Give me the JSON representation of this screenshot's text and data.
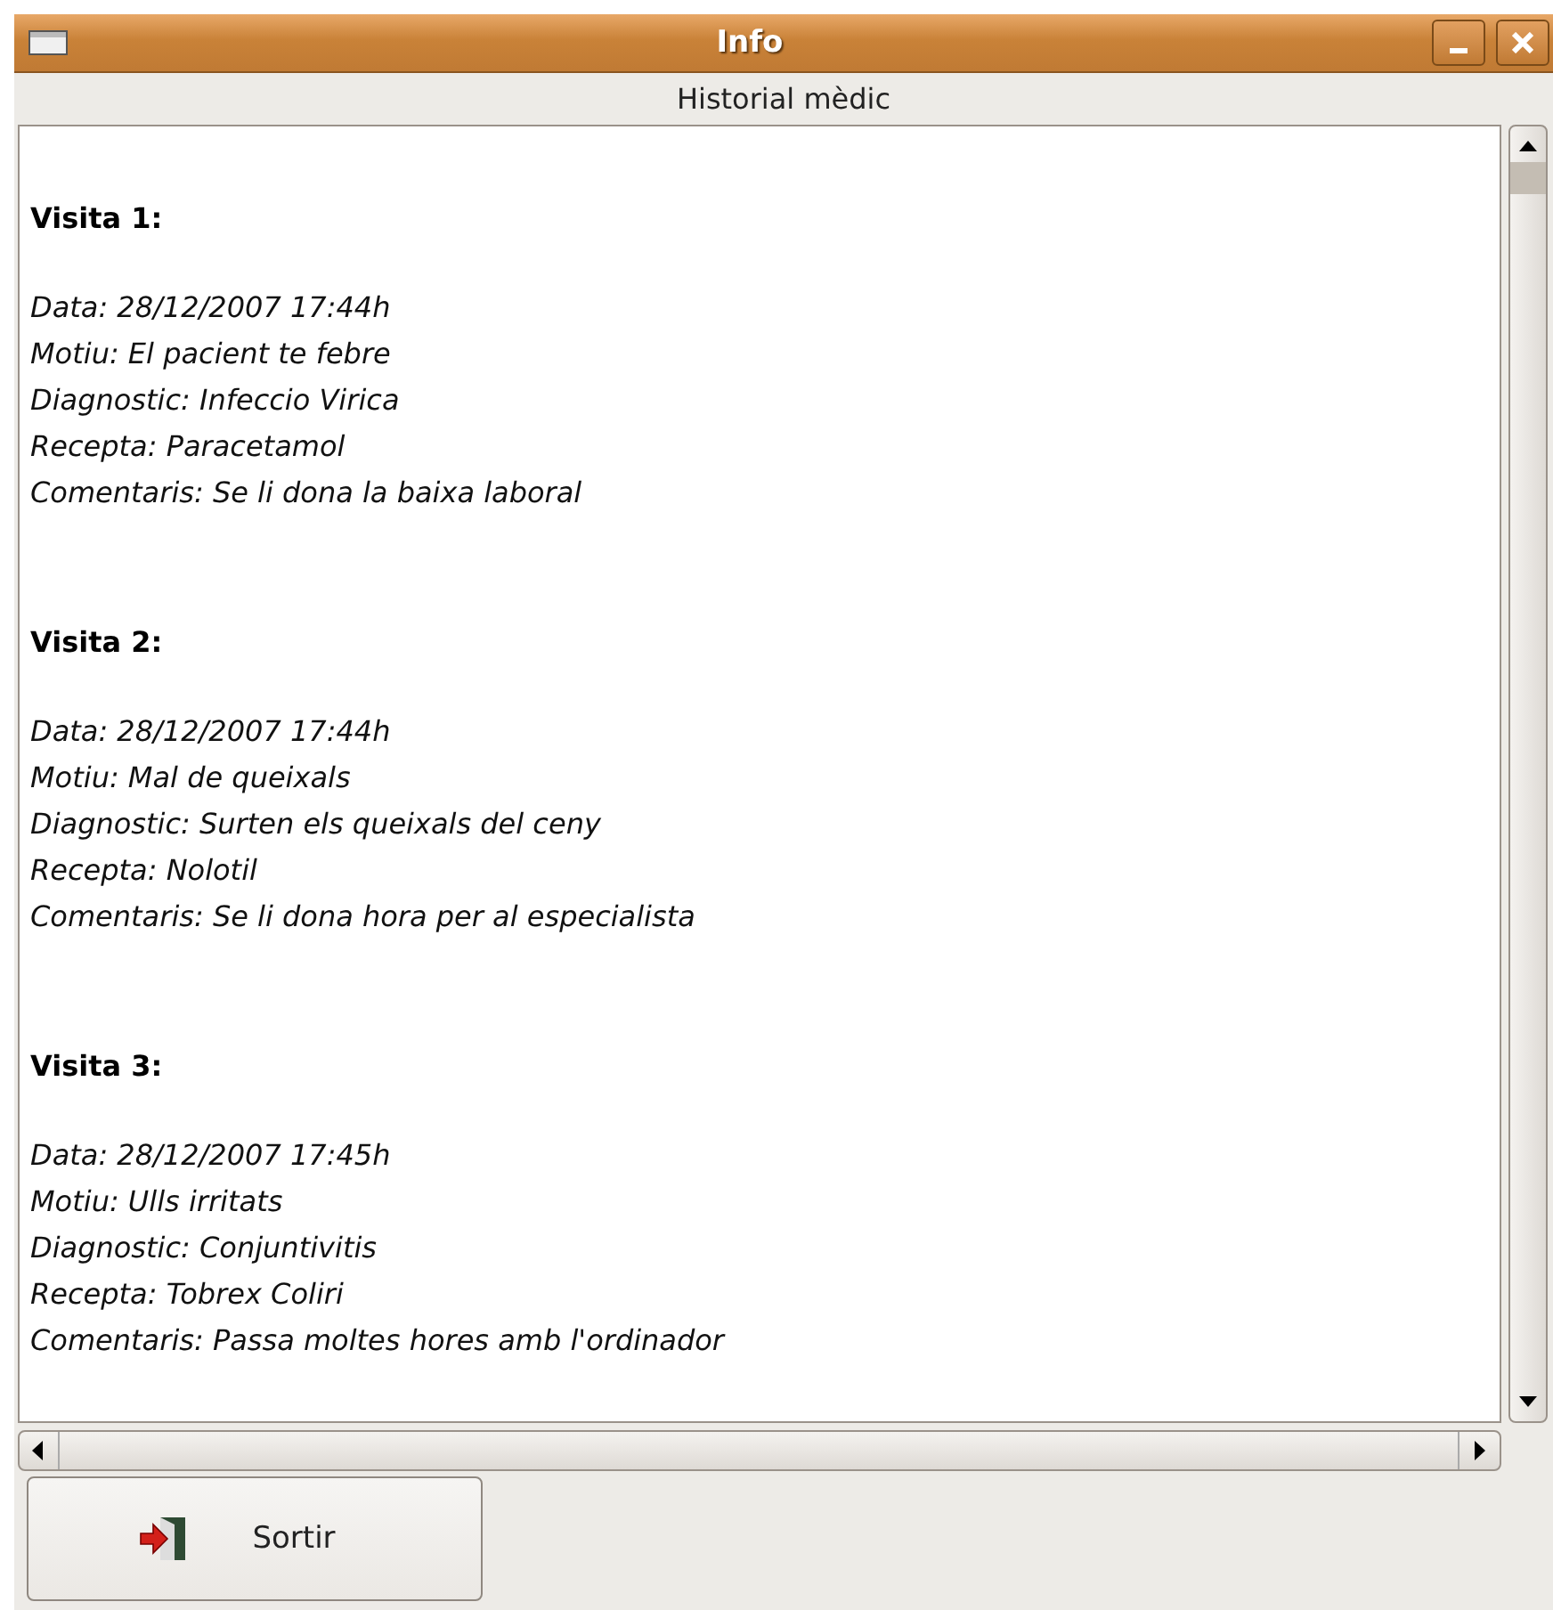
{
  "window": {
    "title": "Info"
  },
  "section_title": "Historial mèdic",
  "visits": [
    {
      "heading": "Visita 1:",
      "lines": [
        "Data: 28/12/2007 17:44h",
        "Motiu: El pacient te febre",
        "Diagnostic: Infeccio Virica",
        "Recepta: Paracetamol",
        "Comentaris: Se li dona la baixa laboral"
      ]
    },
    {
      "heading": "Visita 2:",
      "lines": [
        "Data: 28/12/2007 17:44h",
        "Motiu: Mal de queixals",
        "Diagnostic: Surten els queixals del ceny",
        "Recepta: Nolotil",
        "Comentaris: Se li dona hora per al especialista"
      ]
    },
    {
      "heading": "Visita 3:",
      "lines": [
        "Data: 28/12/2007 17:45h",
        "Motiu: Ulls irritats",
        "Diagnostic: Conjuntivitis",
        "Recepta: Tobrex Coliri",
        "Comentaris: Passa moltes hores amb l'ordinador"
      ]
    }
  ],
  "exit_button": {
    "label": "Sortir"
  }
}
